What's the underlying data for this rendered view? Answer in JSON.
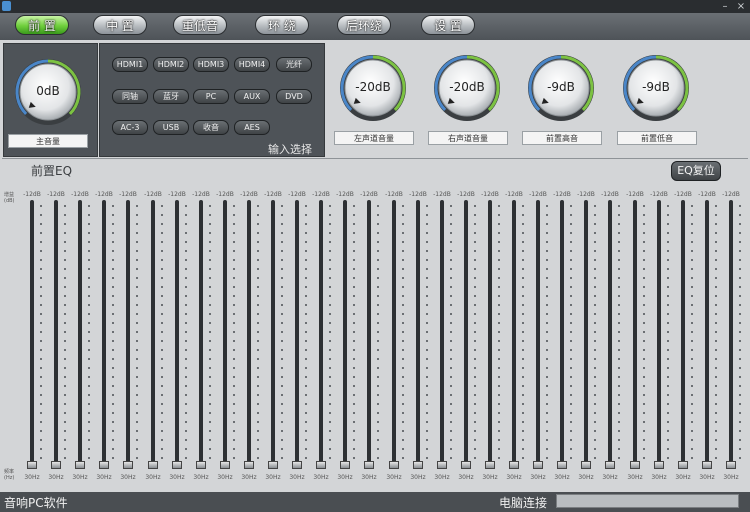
{
  "tabs": [
    {
      "label": "前 置",
      "active": true
    },
    {
      "label": "中 置",
      "active": false
    },
    {
      "label": "重低音",
      "active": false
    },
    {
      "label": "环 绕",
      "active": false
    },
    {
      "label": "后环绕",
      "active": false
    },
    {
      "label": "设 置",
      "active": false
    }
  ],
  "window": {
    "min_label": "–",
    "close_label": "×"
  },
  "master": {
    "value": "0dB",
    "label": "主音量"
  },
  "input_select": {
    "title": "输入选择",
    "buttons": [
      "HDMI1",
      "HDMI2",
      "HDMI3",
      "HDMI4",
      "光纤",
      "同轴",
      "蓝牙",
      "PC",
      "AUX",
      "DVD",
      "AC-3",
      "USB",
      "收音",
      "AES"
    ]
  },
  "knobs": [
    {
      "value": "-20dB",
      "label": "左声道音量"
    },
    {
      "value": "-20dB",
      "label": "右声道音量"
    },
    {
      "value": "-9dB",
      "label": "前置高音"
    },
    {
      "value": "-9dB",
      "label": "前置低音"
    }
  ],
  "eq": {
    "title": "前置EQ",
    "reset_label": "EQ复位",
    "gain_axis": "增益(dB)",
    "freq_axis": "频率(Hz)",
    "band_gain": "-12dB",
    "band_freq": "30Hz",
    "band_count": 30
  },
  "status": {
    "left": "音响PC软件",
    "right": "电脑连接"
  },
  "colors": {
    "active_tab": "#6fcf3c",
    "panel": "#4e5358",
    "knob_ring_green": "#7cc242",
    "knob_ring_blue": "#4a86c8"
  }
}
